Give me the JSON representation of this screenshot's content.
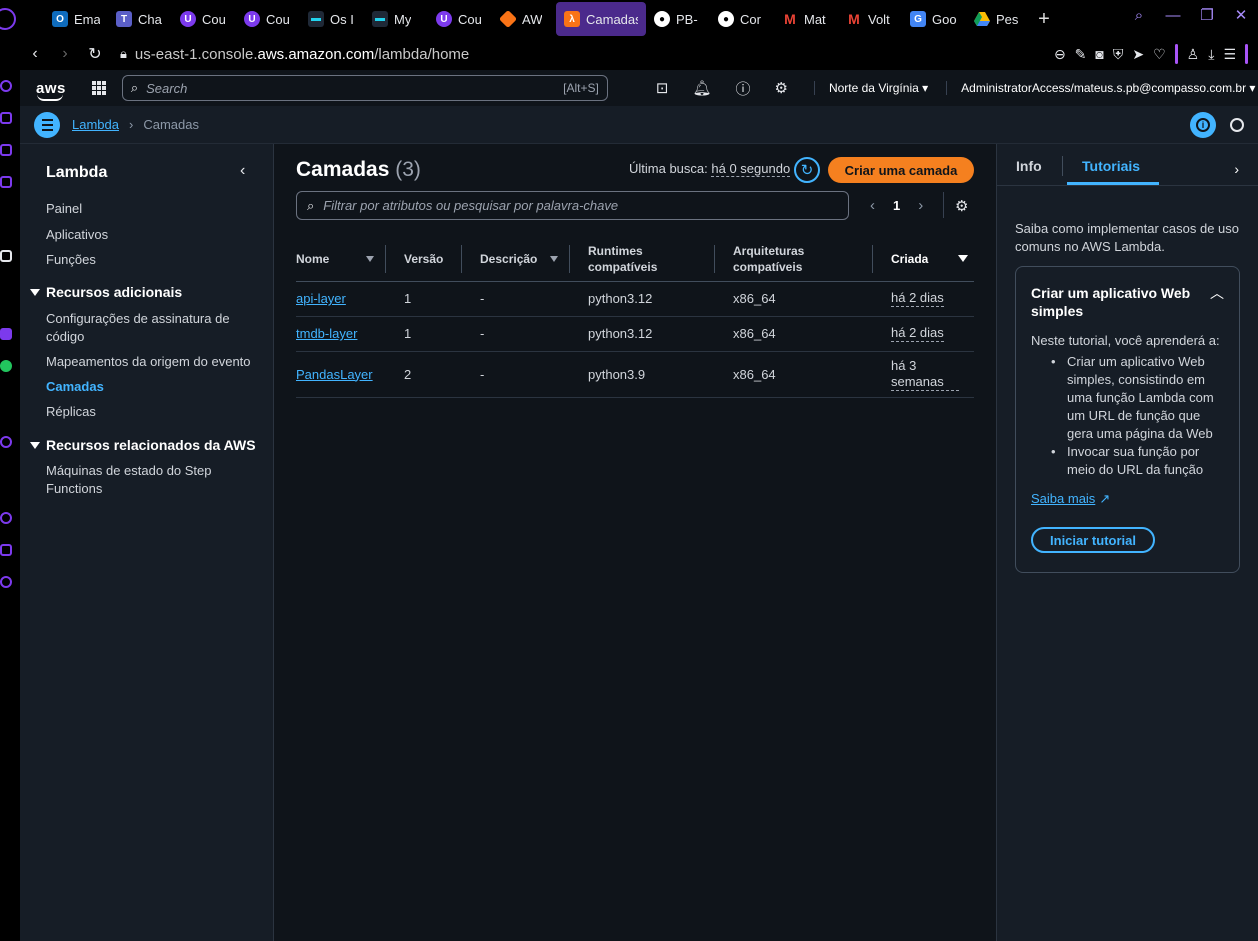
{
  "browser": {
    "tabs": [
      {
        "label": "Ema",
        "icon": "outlook-icon",
        "color": "#0f6cbd"
      },
      {
        "label": "Cha",
        "icon": "teams-icon",
        "color": "#5b5fc7"
      },
      {
        "label": "Cou",
        "icon": "course-icon",
        "color": "#7c3aed"
      },
      {
        "label": "Cou",
        "icon": "course-icon",
        "color": "#7c3aed"
      },
      {
        "label": "Os I",
        "icon": "dash-icon",
        "color": "#1f2937"
      },
      {
        "label": "My",
        "icon": "dash-icon",
        "color": "#1f2937"
      },
      {
        "label": "Cou",
        "icon": "course-icon",
        "color": "#7c3aed"
      },
      {
        "label": "AW",
        "icon": "aws-cube-icon",
        "color": "#f97316"
      },
      {
        "label": "Camadas",
        "icon": "lambda-icon",
        "color": "#f97316",
        "active": true
      },
      {
        "label": "PB-",
        "icon": "github-icon",
        "color": "#000000"
      },
      {
        "label": "Cor",
        "icon": "github-icon",
        "color": "#000000"
      },
      {
        "label": "Mat",
        "icon": "gmail-icon",
        "color": "#ea4335"
      },
      {
        "label": "Volt",
        "icon": "gmail-icon",
        "color": "#ea4335"
      },
      {
        "label": "Goo",
        "icon": "translate-icon",
        "color": "#4285f4"
      },
      {
        "label": "Pes",
        "icon": "drive-icon",
        "color": "#0f9d58"
      }
    ],
    "url_prefix": "us-east-1.console.",
    "url_domain": "aws.amazon.com",
    "url_path": "/lambda/home"
  },
  "awsnav": {
    "logo": "aws",
    "search_placeholder": "Search",
    "search_shortcut": "[Alt+S]",
    "region": "Norte da Virgínia ▾",
    "account": "AdministratorAccess/mateus.s.pb@compasso.com.br ▾"
  },
  "breadcrumb": {
    "root": "Lambda",
    "current": "Camadas"
  },
  "sidebar": {
    "title": "Lambda",
    "items": [
      "Painel",
      "Aplicativos",
      "Funções"
    ],
    "section1": "Recursos adicionais",
    "section1_items": [
      "Configurações de assinatura de código",
      "Mapeamentos da origem do evento",
      "Camadas",
      "Réplicas"
    ],
    "section2": "Recursos relacionados da AWS",
    "section2_items": [
      "Máquinas de estado do Step Functions"
    ]
  },
  "main": {
    "title": "Camadas",
    "count": "(3)",
    "last_fetch_label": "Última busca:",
    "last_fetch_value": "há 0 segundo",
    "create_button": "Criar uma camada",
    "filter_placeholder": "Filtrar por atributos ou pesquisar por palavra-chave",
    "page": "1",
    "columns": [
      "Nome",
      "Versão",
      "Descrição",
      "Runtimes compatíveis",
      "Arquiteturas compatíveis",
      "Criada"
    ],
    "rows": [
      {
        "name": "api-layer",
        "version": "1",
        "description": "-",
        "runtime": "python3.12",
        "arch": "x86_64",
        "created": "há 2 dias"
      },
      {
        "name": "tmdb-layer",
        "version": "1",
        "description": "-",
        "runtime": "python3.12",
        "arch": "x86_64",
        "created": "há 2 dias"
      },
      {
        "name": "PandasLayer",
        "version": "2",
        "description": "-",
        "runtime": "python3.9",
        "arch": "x86_64",
        "created": "há 3 semanas"
      }
    ]
  },
  "help": {
    "tab_info": "Info",
    "tab_tutorials": "Tutoriais",
    "intro": "Saiba como implementar casos de uso comuns no AWS Lambda.",
    "card_title": "Criar um aplicativo Web simples",
    "card_lead": "Neste tutorial, você aprenderá a:",
    "bullets": [
      "Criar um aplicativo Web simples, consistindo em uma função Lambda com um URL de função que gera uma página da Web",
      "Invocar sua função por meio do URL da função"
    ],
    "learn_more": "Saiba mais",
    "start_button": "Iniciar tutorial"
  },
  "colors": {
    "accent": "#42b4ff",
    "primary_button": "#f5801f",
    "active_tab": "#4b2a8c"
  }
}
